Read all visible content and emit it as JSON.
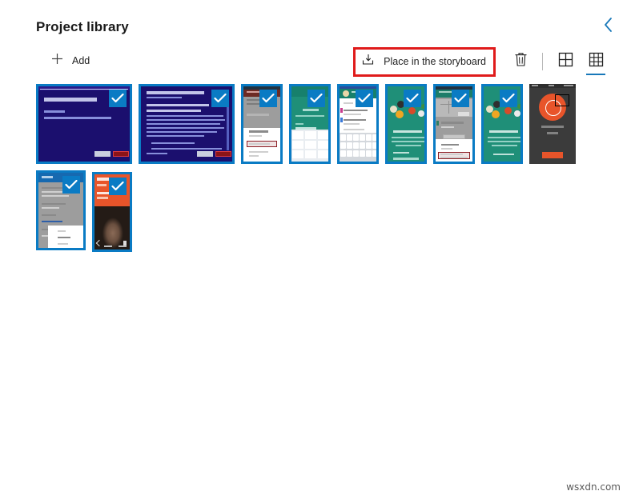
{
  "header": {
    "title": "Project library",
    "back_icon": "chevron-left-icon",
    "back_color": "#1878b9"
  },
  "toolbar": {
    "add_label": "Add",
    "add_icon": "plus-icon",
    "place_label": "Place in the storyboard",
    "place_icon": "place-in-storyboard-icon",
    "delete_icon": "trash-icon",
    "large_grid_icon": "grid-2x2-icon",
    "small_grid_icon": "grid-3x3-icon",
    "active_view": "small_grid",
    "highlight_color": "#e01b1b",
    "accent_color": "#1878b9"
  },
  "library": {
    "selection_check_icon": "checkmark-icon",
    "selected_color": "#0a7bc4",
    "items": [
      {
        "id": 1,
        "kind": "installer-welcome",
        "selected": true,
        "width": 120
      },
      {
        "id": 2,
        "kind": "installer-license",
        "selected": true,
        "width": 120
      },
      {
        "id": 3,
        "kind": "android-list-grey",
        "selected": true,
        "width": 52
      },
      {
        "id": 4,
        "kind": "android-teal-numpad",
        "selected": true,
        "width": 52
      },
      {
        "id": 5,
        "kind": "android-form-keyboard",
        "selected": true,
        "width": 52
      },
      {
        "id": 6,
        "kind": "android-teal-intro",
        "selected": true,
        "width": 52
      },
      {
        "id": 7,
        "kind": "android-map-grey",
        "selected": true,
        "width": 52
      },
      {
        "id": 8,
        "kind": "android-teal-intro2",
        "selected": true,
        "width": 52
      },
      {
        "id": 9,
        "kind": "splash-orange-logo",
        "selected": false,
        "width": 58
      },
      {
        "id": 10,
        "kind": "android-settings",
        "selected": true,
        "width": 62
      },
      {
        "id": 11,
        "kind": "orange-profile-photo",
        "selected": true,
        "width": 50
      }
    ]
  },
  "watermark": {
    "text": "wsxdn.com"
  }
}
